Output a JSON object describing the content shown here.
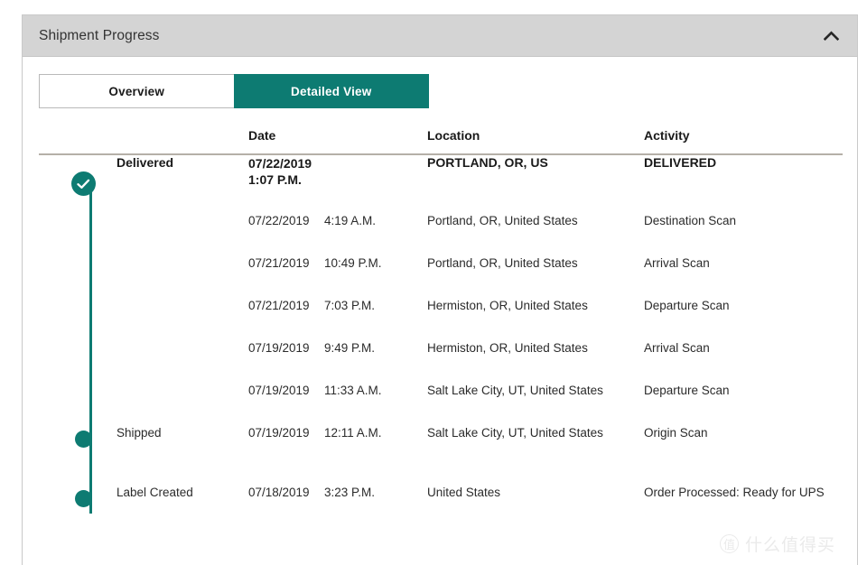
{
  "panel": {
    "title": "Shipment Progress",
    "collapse_icon": "chevron-up-icon",
    "accent_color": "#0d7b72",
    "header_bg": "#d4d4d4"
  },
  "tabs": [
    {
      "label": "Overview",
      "active": false
    },
    {
      "label": "Detailed View",
      "active": true
    }
  ],
  "table": {
    "headers": {
      "marker": "",
      "status": "",
      "date": "Date",
      "location": "Location",
      "activity": "Activity"
    },
    "rows": [
      {
        "marker": "check-circle-icon",
        "status": "Delivered",
        "date": "07/22/2019",
        "time": "1:07 P.M.",
        "location": "PORTLAND, OR, US",
        "activity": "DELIVERED",
        "emphasis": true,
        "milestone": true
      },
      {
        "marker": "",
        "status": "",
        "date": "07/22/2019",
        "time": "4:19 A.M.",
        "location": "Portland, OR, United States",
        "activity": "Destination Scan",
        "emphasis": false,
        "milestone": false
      },
      {
        "marker": "",
        "status": "",
        "date": "07/21/2019",
        "time": "10:49 P.M.",
        "location": "Portland, OR, United States",
        "activity": "Arrival Scan",
        "emphasis": false,
        "milestone": false
      },
      {
        "marker": "",
        "status": "",
        "date": "07/21/2019",
        "time": "7:03 P.M.",
        "location": "Hermiston, OR, United States",
        "activity": "Departure Scan",
        "emphasis": false,
        "milestone": false
      },
      {
        "marker": "",
        "status": "",
        "date": "07/19/2019",
        "time": "9:49 P.M.",
        "location": "Hermiston, OR, United States",
        "activity": "Arrival Scan",
        "emphasis": false,
        "milestone": false
      },
      {
        "marker": "",
        "status": "",
        "date": "07/19/2019",
        "time": "11:33 A.M.",
        "location": "Salt Lake City, UT, United States",
        "activity": "Departure Scan",
        "emphasis": false,
        "milestone": false
      },
      {
        "marker": "pin-dot-icon",
        "status": "Shipped",
        "date": "07/19/2019",
        "time": "12:11 A.M.",
        "location": "Salt Lake City, UT, United States",
        "activity": "Origin Scan",
        "emphasis": false,
        "milestone": true
      },
      {
        "marker": "pin-dot-icon",
        "status": "Label Created",
        "date": "07/18/2019",
        "time": "3:23 P.M.",
        "location": "United States",
        "activity": "Order Processed: Ready for UPS",
        "emphasis": false,
        "milestone": true
      }
    ]
  },
  "watermark": {
    "badge": "值",
    "text": "什么值得买"
  }
}
